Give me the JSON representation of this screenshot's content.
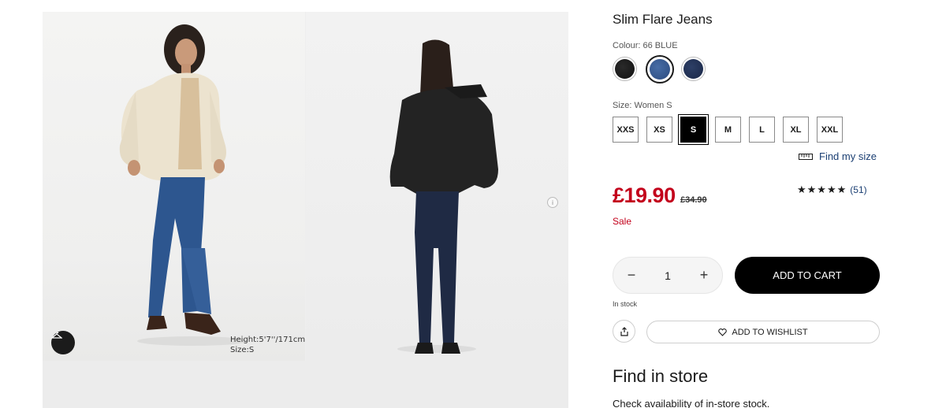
{
  "gallery": {
    "caption_height": "Height:5'7''/171cm",
    "caption_size": "Size:S",
    "hanger_icon": "hanger-icon",
    "info_icon": "info-icon"
  },
  "product": {
    "title": "Slim Flare Jeans",
    "colour_label": "Colour: 66 BLUE",
    "colours": [
      {
        "name": "black",
        "color": "#1a1a1a"
      },
      {
        "name": "blue",
        "color": "#3b5f96",
        "selected": true
      },
      {
        "name": "navy",
        "color": "#233457"
      }
    ],
    "size_label": "Size: Women S",
    "sizes": [
      "XXS",
      "XS",
      "S",
      "M",
      "L",
      "XL",
      "XXL"
    ],
    "selected_size": "S",
    "find_size": "Find my size",
    "price": "£19.90",
    "old_price": "£34.90",
    "rating": 4.5,
    "stars": "★★★★★",
    "review_count": "(51)",
    "sale": "Sale",
    "quantity": "1",
    "add_to_cart": "ADD TO CART",
    "stock": "In stock",
    "wishlist": "ADD TO WISHLIST",
    "store_heading": "Find in store",
    "store_text": "Check availability of in-store stock."
  },
  "colors": {
    "price_red": "#c3001b",
    "link_blue": "#1b3f73",
    "button_black": "#000000"
  }
}
